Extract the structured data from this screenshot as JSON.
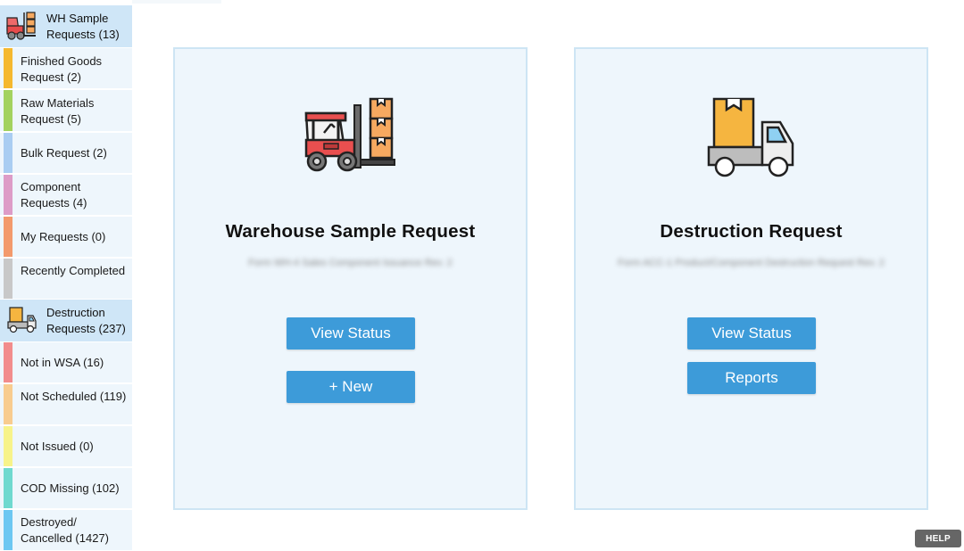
{
  "sidebar": {
    "wh_header": "WH Sample Requests (13)",
    "wh_items": [
      {
        "label": "Finished Goods Request (2)",
        "color": "#f5b82e"
      },
      {
        "label": "Raw Materials Request (5)",
        "color": "#a3d25f"
      },
      {
        "label": "Bulk Request (2)",
        "color": "#a9cdf2"
      },
      {
        "label": "Component Requests (4)",
        "color": "#dd9cc7"
      },
      {
        "label": "My Requests (0)",
        "color": "#f39a6c"
      },
      {
        "label": "Recently Completed",
        "color": "#c8c8c8"
      }
    ],
    "destruction_header": "Destruction Requests (237)",
    "destruction_items": [
      {
        "label": "Not in WSA (16)",
        "color": "#f28c8c"
      },
      {
        "label": "Not Scheduled (119)",
        "color": "#f8cc8f"
      },
      {
        "label": "Not Issued (0)",
        "color": "#f7f38a"
      },
      {
        "label": "COD Missing (102)",
        "color": "#6fd9cf"
      },
      {
        "label": "Destroyed/ Cancelled (1427)",
        "color": "#6cc7f2"
      }
    ]
  },
  "cards": [
    {
      "title": "Warehouse Sample Request",
      "subtitle": "Form WH-4 Sales Component Issuance Rev. 2",
      "icon": "forklift-icon",
      "buttons": [
        "View Status",
        "+ New"
      ]
    },
    {
      "title": "Destruction Request",
      "subtitle": "Form ACC-1 Product/Component Destruction Request Rev. 2",
      "icon": "delivery-truck-icon",
      "buttons": [
        "View Status",
        "Reports"
      ]
    }
  ],
  "help": "HELP",
  "colors": {
    "accent": "#3d9bd9",
    "card_bg": "#eef6fc",
    "sidebar_header_bg": "#cfe6f7"
  }
}
